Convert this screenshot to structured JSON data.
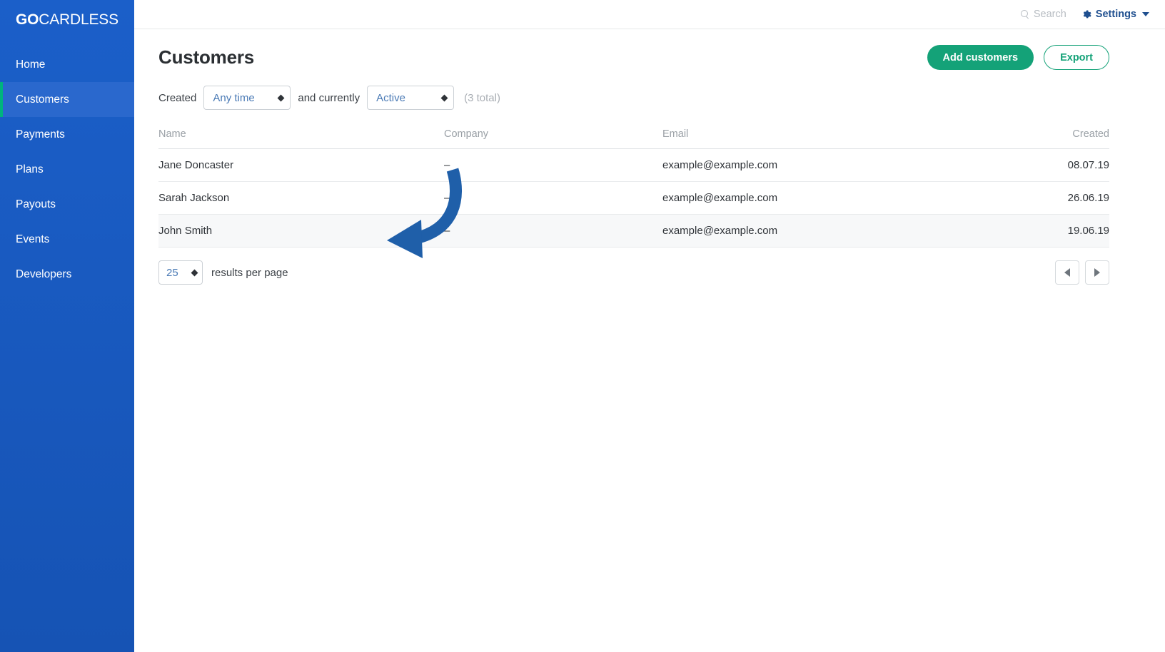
{
  "brand": {
    "logo_bold": "GO",
    "logo_light": "CARDLESS",
    "accent_green": "#00b37e",
    "sidebar_blue": "#1757bd",
    "active_blue": "#2a68cd",
    "primary_green": "#14a278"
  },
  "sidebar": {
    "items": [
      {
        "label": "Home",
        "active": false
      },
      {
        "label": "Customers",
        "active": true
      },
      {
        "label": "Payments",
        "active": false
      },
      {
        "label": "Plans",
        "active": false
      },
      {
        "label": "Payouts",
        "active": false
      },
      {
        "label": "Events",
        "active": false
      },
      {
        "label": "Developers",
        "active": false
      }
    ]
  },
  "topbar": {
    "search_label": "Search",
    "search_icon": "search-icon",
    "settings_label": "Settings",
    "settings_icon": "gear-icon",
    "settings_caret": "chevron-down-icon"
  },
  "page": {
    "title": "Customers",
    "add_button": "Add customers",
    "export_button": "Export"
  },
  "filters": {
    "created_label": "Created",
    "created_value": "Any time",
    "currently_label": "and currently",
    "currently_value": "Active",
    "total_text": "(3 total)"
  },
  "table": {
    "columns": [
      "Name",
      "Company",
      "Email",
      "Created"
    ],
    "rows": [
      {
        "name": "Jane Doncaster",
        "company": "–",
        "email": "example@example.com",
        "created": "08.07.19",
        "hover": false
      },
      {
        "name": "Sarah Jackson",
        "company": "–",
        "email": "example@example.com",
        "created": "26.06.19",
        "hover": false
      },
      {
        "name": "John Smith",
        "company": "–",
        "email": "example@example.com",
        "created": "19.06.19",
        "hover": true
      }
    ]
  },
  "footer": {
    "results_per_page_value": "25",
    "results_per_page_label": "results per page",
    "prev_icon": "triangle-left-icon",
    "next_icon": "triangle-right-icon"
  },
  "annotation": {
    "type": "curved-arrow",
    "color": "#1f5fa9",
    "points_to": "John Smith"
  }
}
